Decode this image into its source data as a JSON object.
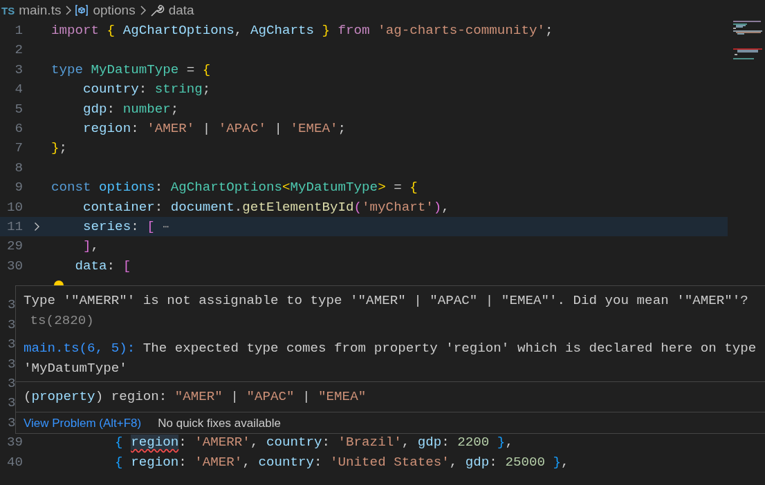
{
  "breadcrumbs": [
    {
      "kind": "file",
      "badge": "TS",
      "label": "main.ts"
    },
    {
      "kind": "variable",
      "label": "options"
    },
    {
      "kind": "property",
      "label": "data"
    }
  ],
  "editor": {
    "lines": [
      {
        "kind": "code",
        "number": "1",
        "highlighted": false,
        "folded": false,
        "lightbulb": false,
        "tokens": [
          {
            "text": "import ",
            "kind": "keyword"
          },
          {
            "text": "{",
            "kind": "bracket-gold"
          },
          {
            "text": " AgChartOptions",
            "kind": "variable"
          },
          {
            "text": ", ",
            "kind": "punctuation"
          },
          {
            "text": "AgCharts ",
            "kind": "variable"
          },
          {
            "text": "}",
            "kind": "bracket-gold"
          },
          {
            "text": " from",
            "kind": "keyword"
          },
          {
            "text": " 'ag-charts-community'",
            "kind": "string"
          },
          {
            "text": ";",
            "kind": "punctuation"
          }
        ]
      },
      {
        "kind": "code",
        "number": "2",
        "highlighted": false,
        "folded": false,
        "lightbulb": false
      },
      {
        "kind": "code",
        "number": "3",
        "highlighted": false,
        "folded": false,
        "lightbulb": false,
        "tokens": [
          {
            "text": "type ",
            "kind": "storage"
          },
          {
            "text": "MyDatumType",
            "kind": "type"
          },
          {
            "text": " = ",
            "kind": "punctuation"
          },
          {
            "text": "{",
            "kind": "bracket-gold"
          }
        ]
      },
      {
        "kind": "code",
        "number": "4",
        "highlighted": false,
        "folded": false,
        "lightbulb": false,
        "tokens": [
          {
            "text": "    country",
            "kind": "variable"
          },
          {
            "text": ": ",
            "kind": "punctuation"
          },
          {
            "text": "string",
            "kind": "type"
          },
          {
            "text": ";",
            "kind": "punctuation"
          }
        ]
      },
      {
        "kind": "code",
        "number": "5",
        "highlighted": false,
        "folded": false,
        "lightbulb": false,
        "tokens": [
          {
            "text": "    gdp",
            "kind": "variable"
          },
          {
            "text": ": ",
            "kind": "punctuation"
          },
          {
            "text": "number",
            "kind": "type"
          },
          {
            "text": ";",
            "kind": "punctuation"
          }
        ]
      },
      {
        "kind": "code",
        "number": "6",
        "highlighted": false,
        "folded": false,
        "lightbulb": false,
        "tokens": [
          {
            "text": "    region",
            "kind": "variable"
          },
          {
            "text": ": ",
            "kind": "punctuation"
          },
          {
            "text": "'AMER'",
            "kind": "string"
          },
          {
            "text": " | ",
            "kind": "punctuation"
          },
          {
            "text": "'APAC'",
            "kind": "string"
          },
          {
            "text": " | ",
            "kind": "punctuation"
          },
          {
            "text": "'EMEA'",
            "kind": "string"
          },
          {
            "text": ";",
            "kind": "punctuation"
          }
        ]
      },
      {
        "kind": "code",
        "number": "7",
        "highlighted": false,
        "folded": false,
        "lightbulb": false,
        "tokens": [
          {
            "text": "}",
            "kind": "bracket-gold"
          },
          {
            "text": ";",
            "kind": "punctuation"
          }
        ]
      },
      {
        "kind": "code",
        "number": "8",
        "highlighted": false,
        "folded": false,
        "lightbulb": false
      },
      {
        "kind": "code",
        "number": "9",
        "highlighted": false,
        "folded": false,
        "lightbulb": false,
        "tokens": [
          {
            "text": "const ",
            "kind": "storage"
          },
          {
            "text": "options",
            "kind": "constant"
          },
          {
            "text": ": ",
            "kind": "punctuation"
          },
          {
            "text": "AgChartOptions",
            "kind": "type"
          },
          {
            "text": "<",
            "kind": "bracket-gold"
          },
          {
            "text": "MyDatumType",
            "kind": "type"
          },
          {
            "text": ">",
            "kind": "bracket-gold"
          },
          {
            "text": " = ",
            "kind": "punctuation"
          },
          {
            "text": "{",
            "kind": "bracket-gold"
          }
        ]
      },
      {
        "kind": "code",
        "number": "10",
        "highlighted": false,
        "folded": false,
        "lightbulb": false,
        "tokens": [
          {
            "text": "    container",
            "kind": "variable"
          },
          {
            "text": ": ",
            "kind": "punctuation"
          },
          {
            "text": "document",
            "kind": "variable"
          },
          {
            "text": ".",
            "kind": "punctuation"
          },
          {
            "text": "getElementById",
            "kind": "function"
          },
          {
            "text": "(",
            "kind": "bracket-pink"
          },
          {
            "text": "'myChart'",
            "kind": "string"
          },
          {
            "text": ")",
            "kind": "bracket-pink"
          },
          {
            "text": ",",
            "kind": "punctuation"
          }
        ]
      },
      {
        "kind": "code",
        "number": "11",
        "highlighted": true,
        "folded": true,
        "lightbulb": false,
        "tokens": [
          {
            "text": "    series",
            "kind": "variable"
          },
          {
            "text": ": ",
            "kind": "punctuation"
          },
          {
            "text": "[ ",
            "kind": "bracket-pink"
          },
          {
            "text": "⋯",
            "kind": "fold-ellipsis"
          }
        ]
      },
      {
        "kind": "code",
        "number": "29",
        "highlighted": false,
        "folded": false,
        "lightbulb": false,
        "tokens": [
          {
            "text": "    ]",
            "kind": "bracket-pink"
          },
          {
            "text": ",",
            "kind": "punctuation"
          }
        ]
      },
      {
        "kind": "code",
        "number": "30",
        "highlighted": false,
        "folded": false,
        "lightbulb": false,
        "tokens": [
          {
            "text": "   data",
            "kind": "variable"
          },
          {
            "text": ": ",
            "kind": "punctuation"
          },
          {
            "text": "[",
            "kind": "bracket-pink"
          }
        ]
      },
      {
        "kind": "code",
        "highlighted": false,
        "folded": false,
        "lightbulb": true
      },
      {
        "kind": "covered",
        "number": "3"
      },
      {
        "kind": "covered",
        "number": "3"
      },
      {
        "kind": "covered",
        "number": "3"
      },
      {
        "kind": "covered",
        "number": "3"
      },
      {
        "kind": "covered",
        "number": "3"
      },
      {
        "kind": "covered",
        "number": "3"
      },
      {
        "kind": "covered",
        "number": "3"
      },
      {
        "kind": "code",
        "number": "39",
        "highlighted": false,
        "folded": false,
        "lightbulb": false,
        "tokens": [
          {
            "text": "        { ",
            "kind": "bracket-blue"
          },
          {
            "text": "region",
            "kind": "error-variable"
          },
          {
            "text": ": ",
            "kind": "punctuation"
          },
          {
            "text": "'AMERR'",
            "kind": "string"
          },
          {
            "text": ", ",
            "kind": "punctuation"
          },
          {
            "text": "country",
            "kind": "variable"
          },
          {
            "text": ": ",
            "kind": "punctuation"
          },
          {
            "text": "'Brazil'",
            "kind": "string"
          },
          {
            "text": ", ",
            "kind": "punctuation"
          },
          {
            "text": "gdp",
            "kind": "variable"
          },
          {
            "text": ": ",
            "kind": "punctuation"
          },
          {
            "text": "2200",
            "kind": "number"
          },
          {
            "text": " }",
            "kind": "bracket-blue"
          },
          {
            "text": ",",
            "kind": "punctuation"
          }
        ]
      },
      {
        "kind": "code",
        "number": "40",
        "highlighted": false,
        "folded": false,
        "lightbulb": false,
        "tokens": [
          {
            "text": "        { ",
            "kind": "bracket-blue"
          },
          {
            "text": "region",
            "kind": "variable"
          },
          {
            "text": ": ",
            "kind": "punctuation"
          },
          {
            "text": "'AMER'",
            "kind": "string"
          },
          {
            "text": ", ",
            "kind": "punctuation"
          },
          {
            "text": "country",
            "kind": "variable"
          },
          {
            "text": ": ",
            "kind": "punctuation"
          },
          {
            "text": "'United States'",
            "kind": "string"
          },
          {
            "text": ", ",
            "kind": "punctuation"
          },
          {
            "text": "gdp",
            "kind": "variable"
          },
          {
            "text": ": ",
            "kind": "punctuation"
          },
          {
            "text": "25000",
            "kind": "number"
          },
          {
            "text": " }",
            "kind": "bracket-blue"
          },
          {
            "text": ",",
            "kind": "punctuation"
          }
        ]
      }
    ]
  },
  "hover": {
    "message": "Type '\"AMERR\"' is not assignable to type '\"AMER\" | \"APAC\" | \"EMEA\"'. Did you mean '\"AMER\"'?",
    "code": "ts(2820)",
    "related": {
      "location": "main.ts(6, 5):",
      "text": " The expected type comes from property 'region' which is declared here on type 'MyDatumType'"
    },
    "signature": [
      {
        "text": "(",
        "kind": "punctuation"
      },
      {
        "text": "property",
        "kind": "variable"
      },
      {
        "text": ") region: ",
        "kind": "punctuation"
      },
      {
        "text": "\"AMER\"",
        "kind": "string"
      },
      {
        "text": " | ",
        "kind": "punctuation"
      },
      {
        "text": "\"APAC\"",
        "kind": "string"
      },
      {
        "text": " | ",
        "kind": "punctuation"
      },
      {
        "text": "\"EMEA\"",
        "kind": "string"
      }
    ],
    "actions": [
      {
        "kind": "link",
        "label": "View Problem (Alt+F8)"
      },
      {
        "kind": "note",
        "label": "No quick fixes available"
      }
    ]
  }
}
